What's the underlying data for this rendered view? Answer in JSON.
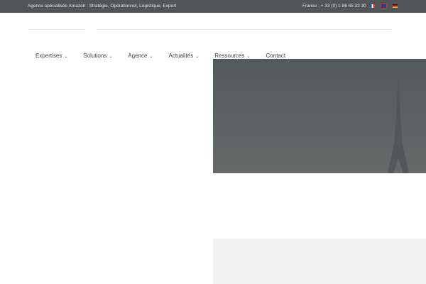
{
  "topbar": {
    "tagline": "Agence spécialisée Amazon : Stratégie, Opérationnel, Logistique, Export",
    "phone": "France : + 33 (0) 1 86 65 32 30",
    "languages": [
      "fr",
      "en",
      "de"
    ]
  },
  "nav": {
    "items": [
      {
        "label": "Expertises",
        "dropdown": true
      },
      {
        "label": "Solutions",
        "dropdown": true
      },
      {
        "label": "Agence",
        "dropdown": true
      },
      {
        "label": "Actualités",
        "dropdown": true
      },
      {
        "label": "Ressources",
        "dropdown": true
      },
      {
        "label": "Contact",
        "dropdown": false
      }
    ],
    "chevron": "⌄"
  }
}
